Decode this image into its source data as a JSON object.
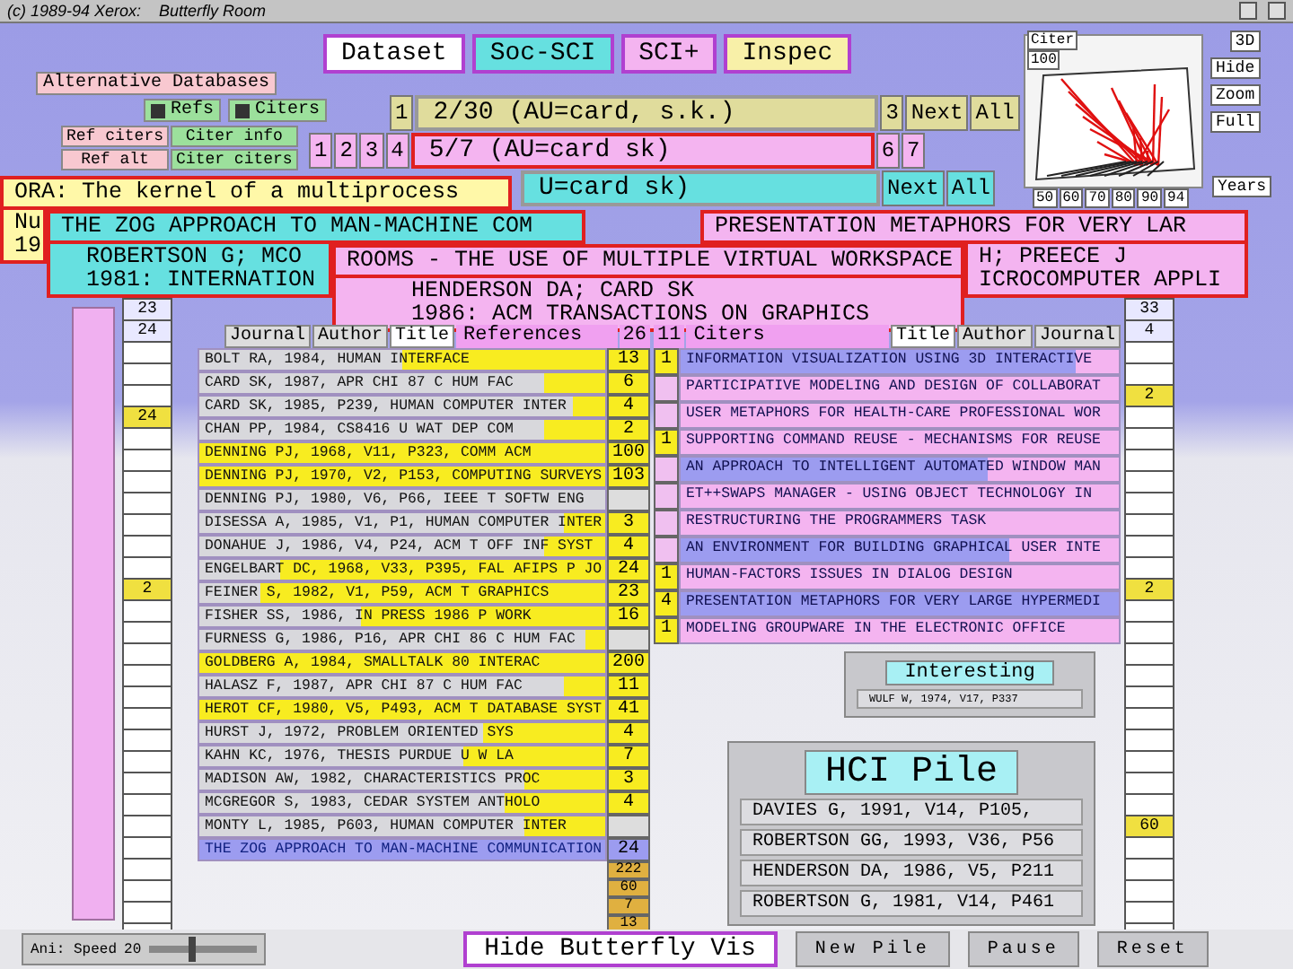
{
  "window": {
    "title": "(c) 1989-94 Xerox:    Butterfly Room"
  },
  "datasets": [
    {
      "label": "Dataset",
      "color": "#ffffff"
    },
    {
      "label": "Soc-SCI",
      "color": "#66e0e0"
    },
    {
      "label": "SCI+",
      "color": "#f4b4f0"
    },
    {
      "label": "Inspec",
      "color": "#f8f0a8"
    }
  ],
  "options": {
    "title": "Alternative Databases",
    "toggles": [
      {
        "label": "Refs",
        "checked": true
      },
      {
        "label": "Citers",
        "checked": true
      }
    ],
    "buttons": [
      {
        "label": "Ref citers",
        "kind": "ref"
      },
      {
        "label": "Citer info",
        "kind": "citer"
      },
      {
        "label": "Ref alt",
        "kind": "ref"
      },
      {
        "label": "Citer citers",
        "kind": "citer"
      }
    ]
  },
  "queries": [
    {
      "label": "2/30 (AU=card, s.k.)",
      "color": "#e0dc9c",
      "pages_before": [
        "1"
      ],
      "pages_after": [
        "3"
      ],
      "next": "Next",
      "all": "All",
      "selected": false
    },
    {
      "label": "5/7 (AU=card sk)",
      "color": "#f4b4f0",
      "pages_before": [
        "1",
        "2",
        "3",
        "4"
      ],
      "pages_after": [
        "6",
        "7"
      ],
      "selected": true
    },
    {
      "label": "U=card sk)",
      "color": "#66e0e0",
      "next": "Next",
      "all": "All",
      "selected": false
    }
  ],
  "cards": [
    {
      "heading": "ORA: The kernel of a multiprocess",
      "details": [
        "Nu",
        "19"
      ],
      "color": "#fff8a8"
    },
    {
      "heading": "THE ZOG APPROACH TO MAN-MACHINE COM",
      "details": [
        "ROBERTSON G; MCO",
        "1981: INTERNATION"
      ],
      "color": "#66e0e0"
    },
    {
      "heading": "PRESENTATION METAPHORS FOR VERY LAR",
      "details": [
        "H; PREECE J",
        "ICROCOMPUTER APPLI"
      ],
      "color": "#f4b4f0"
    },
    {
      "heading": "ROOMS - THE USE OF MULTIPLE VIRTUAL WORKSPACE",
      "details": [
        "HENDERSON DA; CARD SK",
        "1986: ACM TRANSACTIONS ON GRAPHICS"
      ],
      "color": "#f4b4f0"
    }
  ],
  "overview": {
    "label": "Citer",
    "count": "100",
    "buttons": [
      "3D",
      "Hide",
      "Zoom",
      "Full"
    ],
    "axis_label": "Years",
    "years": [
      "50",
      "60",
      "70",
      "80",
      "90",
      "94"
    ]
  },
  "references": {
    "tabs": [
      {
        "label": "Journal",
        "selected": false
      },
      {
        "label": "Author",
        "selected": false
      },
      {
        "label": "Title",
        "selected": true
      }
    ],
    "title": "References",
    "count": "26",
    "rows": [
      {
        "text": "BOLT RA, 1984, HUMAN INTERFACE",
        "level": 0.5,
        "current": false,
        "count": "13"
      },
      {
        "text": "CARD SK, 1987, APR CHI 87 C HUM FAC",
        "level": 0.15,
        "current": false,
        "count": "6"
      },
      {
        "text": "CARD SK, 1985, P239, HUMAN COMPUTER INTER",
        "level": 0.08,
        "current": false,
        "count": "4"
      },
      {
        "text": "CHAN PP, 1984, CS8416 U WAT DEP COM",
        "level": 0.15,
        "current": false,
        "count": "2"
      },
      {
        "text": "DENNING PJ, 1968, V11, P323, COMM ACM",
        "level": 1,
        "current": false,
        "count": "100"
      },
      {
        "text": "DENNING PJ, 1970, V2, P153, COMPUTING SURVEYS",
        "level": 1,
        "current": false,
        "count": "103"
      },
      {
        "text": "DENNING PJ, 1980, V6, P66, IEEE T SOFTW ENG",
        "current": false
      },
      {
        "text": "DISESSA A, 1985, V1, P1, HUMAN COMPUTER INTER",
        "level": 0.1,
        "current": false,
        "count": "3"
      },
      {
        "text": "DONAHUE J, 1986, V4, P24, ACM T OFF INF SYST",
        "level": 0.15,
        "current": false,
        "count": "4"
      },
      {
        "text": "ENGELBART DC, 1968, V33, P395, FAL AFIPS P JO",
        "level": 0.8,
        "current": false,
        "count": "24"
      },
      {
        "text": "FEINER S, 1982, V1, P59, ACM T GRAPHICS",
        "level": 0.85,
        "current": false,
        "count": "23"
      },
      {
        "text": "FISHER SS, 1986, IN PRESS 1986 P WORK",
        "level": 0.6,
        "current": false,
        "count": "16"
      },
      {
        "text": "FURNESS G, 1986, P16, APR CHI 86 C HUM FAC",
        "level": 0.05,
        "current": false
      },
      {
        "text": "GOLDBERG A, 1984, SMALLTALK 80 INTERAC",
        "level": 1,
        "current": false,
        "count": "200"
      },
      {
        "text": "HALASZ F, 1987, APR CHI 87 C HUM FAC",
        "level": 0.1,
        "current": false,
        "count": "11"
      },
      {
        "text": "HEROT CF, 1980, V5, P493, ACM T DATABASE SYST",
        "level": 1,
        "current": false,
        "count": "41"
      },
      {
        "text": "HURST J, 1972, PROBLEM ORIENTED SYS",
        "level": 0.3,
        "current": false,
        "count": "4"
      },
      {
        "text": "KAHN KC, 1976, THESIS PURDUE U W LA",
        "level": 0.35,
        "current": false,
        "count": "7"
      },
      {
        "text": "MADISON AW, 1982, CHARACTERISTICS PROC",
        "level": 0.2,
        "current": false,
        "count": "3"
      },
      {
        "text": "MCGREGOR S, 1983, CEDAR SYSTEM ANTHOLO",
        "level": 0.25,
        "current": false,
        "count": "4"
      },
      {
        "text": "MONTY L, 1985, P603, HUMAN COMPUTER INTER",
        "level": 0.2,
        "current": false
      },
      {
        "text": "THE ZOG APPROACH TO MAN-MACHINE COMMUNICATION",
        "current": true,
        "count": "24"
      }
    ],
    "extra_counts": [
      "222",
      "60",
      "7",
      "13"
    ]
  },
  "citers": {
    "count": "11",
    "title": "Citers",
    "tabs": [
      {
        "label": "Title",
        "selected": true
      },
      {
        "label": "Author",
        "selected": false
      },
      {
        "label": "Journal",
        "selected": false
      }
    ],
    "rows": [
      {
        "text": "INFORMATION VISUALIZATION USING 3D INTERACTIVE",
        "level": 0.9,
        "count": "1"
      },
      {
        "text": "PARTICIPATIVE MODELING AND DESIGN OF COLLABORAT"
      },
      {
        "text": "USER METAPHORS FOR HEALTH-CARE PROFESSIONAL WOR"
      },
      {
        "text": "SUPPORTING COMMAND REUSE - MECHANISMS FOR REUSE",
        "count": "1"
      },
      {
        "text": "AN APPROACH TO INTELLIGENT AUTOMATED WINDOW MAN",
        "level": 0.7
      },
      {
        "text": "ET++SWAPS MANAGER - USING OBJECT TECHNOLOGY IN"
      },
      {
        "text": "RESTRUCTURING THE PROGRAMMERS TASK"
      },
      {
        "text": "AN ENVIRONMENT FOR BUILDING GRAPHICAL USER INTE",
        "level": 0.75
      },
      {
        "text": "HUMAN-FACTORS ISSUES IN DIALOG DESIGN",
        "count": "1"
      },
      {
        "text": "PRESENTATION METAPHORS FOR VERY LARGE HYPERMEDI",
        "level": 1,
        "count": "4"
      },
      {
        "text": "MODELING GROUPWARE IN THE ELECTRONIC OFFICE",
        "count": "1"
      }
    ]
  },
  "columns": [
    {
      "header": [
        "23",
        "24"
      ],
      "marks": [
        "24",
        "2"
      ]
    },
    {
      "header": [
        "33",
        "4"
      ],
      "marks": [
        "2",
        "2",
        "60"
      ]
    }
  ],
  "piles": [
    {
      "title": "Interesting",
      "entries": [
        "WULF W, 1974, V17, P337"
      ]
    },
    {
      "title": "HCI Pile",
      "entries": [
        "DAVIES G, 1991, V14, P105,",
        "ROBERTSON GG, 1993, V36, P56",
        "HENDERSON DA, 1986, V5, P211",
        "ROBERTSON G, 1981, V14, P461"
      ]
    }
  ],
  "speed": {
    "label": "Ani: Speed",
    "value": "20",
    "level": 0.4
  },
  "buttons": [
    {
      "label": "Hide Butterfly Vis",
      "kind": "primary"
    },
    {
      "label": "New Pile",
      "kind": "flat"
    },
    {
      "label": "Pause",
      "kind": "flat"
    },
    {
      "label": "Reset",
      "kind": "flat"
    }
  ]
}
